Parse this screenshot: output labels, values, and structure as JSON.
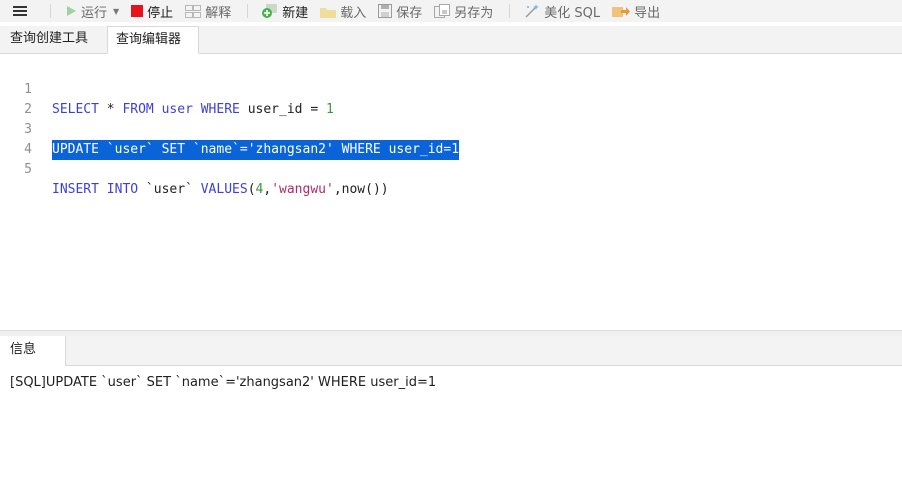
{
  "toolbar": {
    "run": "运行",
    "stop": "停止",
    "explain": "解释",
    "new": "新建",
    "load": "载入",
    "save": "保存",
    "save_as": "另存为",
    "beautify": "美化 SQL",
    "export": "导出"
  },
  "tabs": {
    "query_builder": "查询创建工具",
    "query_editor": "查询编辑器"
  },
  "editor": {
    "line_numbers": [
      "1",
      "2",
      "3",
      "4",
      "5"
    ],
    "line1": {
      "kw_select": "SELECT",
      "star": " * ",
      "kw_from": "FROM",
      "sp1": " ",
      "tbl": "user",
      "sp2": " ",
      "kw_where": "WHERE",
      "cond": " user_id = ",
      "val": "1"
    },
    "line3": {
      "kw_update": "UPDATE",
      "t1": " `user` ",
      "kw_set": "SET",
      "t2": " `name`=",
      "str": "'zhangsan2'",
      "sp": " ",
      "kw_where": "WHERE",
      "cond": " user_id=",
      "val": "1"
    },
    "line5": {
      "kw_insert": "INSERT",
      "sp1": " ",
      "kw_into": "INTO",
      "t1": " `user` ",
      "kw_values": "VALUES",
      "p1": "(",
      "n": "4",
      "comma1": ",",
      "str": "'wangwu'",
      "rest": ",now())"
    }
  },
  "info": {
    "tab": "信息",
    "message": "[SQL]UPDATE `user` SET `name`='zhangsan2' WHERE user_id=1"
  },
  "colors": {
    "keyword": "#3f3fd6",
    "string": "#b02b66",
    "number": "#3a9a3a",
    "selection": "#0a64d8",
    "stop_red": "#e8121b",
    "run_green": "#47b24a"
  },
  "icons": [
    "menu-icon",
    "run-icon",
    "stop-icon",
    "explain-icon",
    "new-icon",
    "load-icon",
    "save-icon",
    "save-as-icon",
    "beautify-icon",
    "export-icon"
  ]
}
